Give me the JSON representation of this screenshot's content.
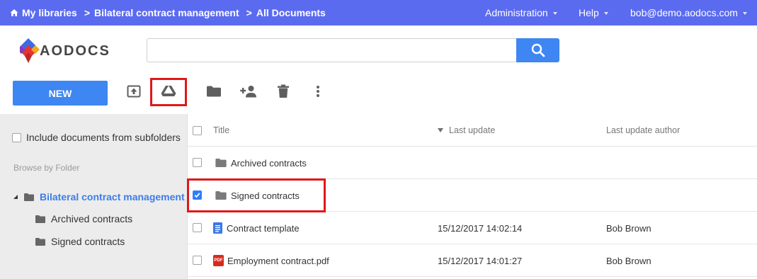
{
  "topbar": {
    "crumbs": [
      "My libraries",
      "Bilateral contract management",
      "All Documents"
    ],
    "menus": [
      "Administration",
      "Help",
      "bob@demo.aodocs.com"
    ],
    "color": "#5b6bef"
  },
  "logo": {
    "text": "AODOCS"
  },
  "search": {
    "value": "",
    "placeholder": ""
  },
  "toolbar": {
    "new_label": "NEW",
    "icons": [
      "upload-icon",
      "google-drive-icon",
      "folder-icon",
      "add-person-icon",
      "trash-icon",
      "more-vert-icon"
    ]
  },
  "sidebar": {
    "include_subfolders": "Include documents from subfolders",
    "browse_label": "Browse by Folder",
    "root": "Bilateral contract management",
    "children": [
      "Archived contracts",
      "Signed contracts"
    ]
  },
  "table": {
    "headers": {
      "title": "Title",
      "last_update": "Last update",
      "author": "Last update author"
    },
    "rows": [
      {
        "title": "Archived contracts",
        "type": "folder",
        "date": "",
        "author": "",
        "checked": false
      },
      {
        "title": "Signed contracts",
        "type": "folder",
        "date": "",
        "author": "",
        "checked": true
      },
      {
        "title": "Contract template",
        "type": "doc",
        "date": "15/12/2017 14:02:14",
        "author": "Bob Brown",
        "checked": false
      },
      {
        "title": "Employment contract.pdf",
        "type": "pdf",
        "date": "15/12/2017 14:01:27",
        "author": "Bob Brown",
        "checked": false
      }
    ],
    "pdf_badge": "PDF"
  },
  "colors": {
    "accent": "#3e86f2",
    "highlight": "#e01818",
    "link": "#3e7de8"
  }
}
